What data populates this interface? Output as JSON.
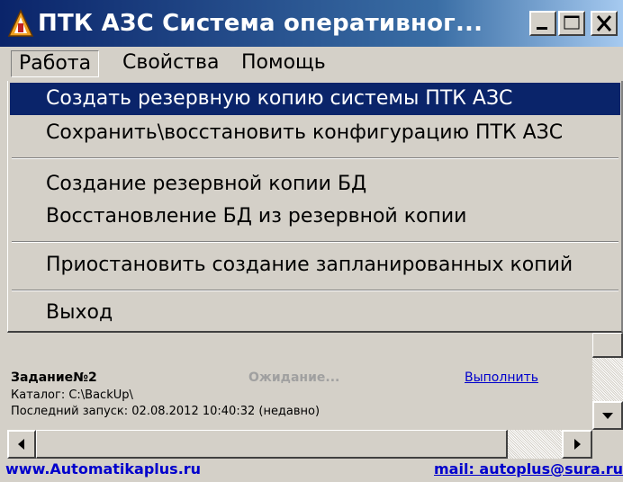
{
  "window": {
    "title": "ПТК АЗС Система оперативног...",
    "controls": {
      "minimize": "minimize-icon",
      "maximize": "maximize-icon",
      "close": "close-icon"
    }
  },
  "menubar": {
    "items": [
      {
        "label": "Работа",
        "open": true
      },
      {
        "label": "Свойства"
      },
      {
        "label": "Помощь"
      }
    ]
  },
  "dropdown": {
    "items": [
      {
        "label": "Создать резервную копию системы ПТК АЗС",
        "selected": true
      },
      {
        "label": "Сохранить\\восстановить конфигурацию ПТК АЗС"
      },
      {
        "label": "Создание резервной копии БД"
      },
      {
        "label": "Восстановление БД из резервной копии"
      },
      {
        "label": "Приостановить создание запланированных копий"
      },
      {
        "label": "Выход"
      }
    ]
  },
  "task": {
    "name": "Задание№2",
    "status": "Ожидание...",
    "action": "Выполнить",
    "directory": "Каталог: C:\\BackUp\\",
    "last_run": "Последний запуск: 02.08.2012 10:40:32 (недавно)"
  },
  "footer": {
    "site": "www.Automatikaplus.ru",
    "mail": "mail: autoplus@sura.ru"
  },
  "colors": {
    "title_bar": "#0a246a",
    "selection": "#0a246a",
    "link": "#0000cc",
    "status_gray": "#a0a0a0",
    "face": "#d4d0c8"
  }
}
